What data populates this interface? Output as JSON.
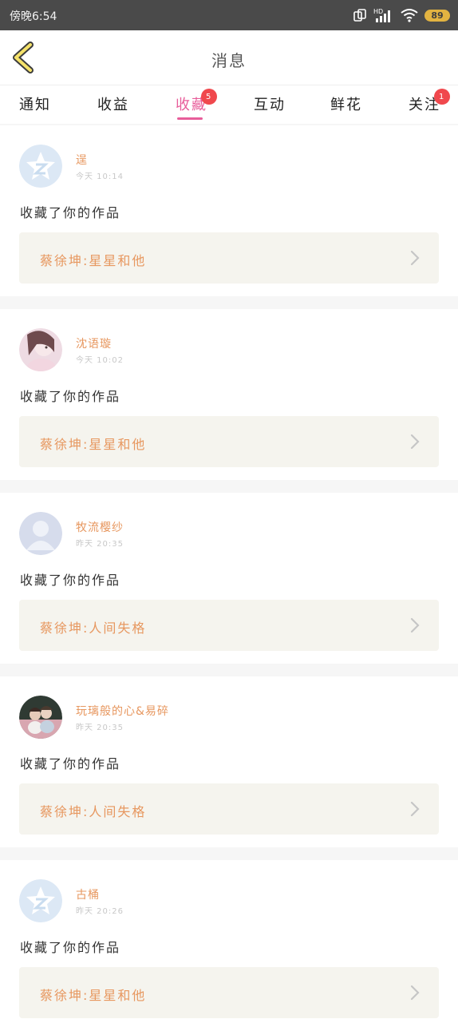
{
  "status_bar": {
    "time": "傍晚6:54",
    "network": "HD",
    "battery": "89"
  },
  "header": {
    "title": "消息"
  },
  "tabs": [
    {
      "label": "通知",
      "badge": ""
    },
    {
      "label": "收益",
      "badge": ""
    },
    {
      "label": "收藏",
      "badge": "5",
      "active": true
    },
    {
      "label": "互动",
      "badge": ""
    },
    {
      "label": "鲜花",
      "badge": ""
    },
    {
      "label": "关注",
      "badge": "1"
    }
  ],
  "items": [
    {
      "name": "逞",
      "time": "今天 10:14",
      "action": "收藏了你的作品",
      "work": "蔡徐坤:星星和他",
      "avatar": "qq-default"
    },
    {
      "name": "沈语璇",
      "time": "今天 10:02",
      "action": "收藏了你的作品",
      "work": "蔡徐坤:星星和他",
      "avatar": "girl-photo"
    },
    {
      "name": "牧流樱纱",
      "time": "昨天 20:35",
      "action": "收藏了你的作品",
      "work": "蔡徐坤:人间失格",
      "avatar": "default-person"
    },
    {
      "name": "玩璃般的心&易碎",
      "time": "昨天 20:35",
      "action": "收藏了你的作品",
      "work": "蔡徐坤:人间失格",
      "avatar": "couple-photo"
    },
    {
      "name": "古桶",
      "time": "昨天 20:26",
      "action": "收藏了你的作品",
      "work": "蔡徐坤:星星和他",
      "avatar": "qq-default"
    }
  ]
}
